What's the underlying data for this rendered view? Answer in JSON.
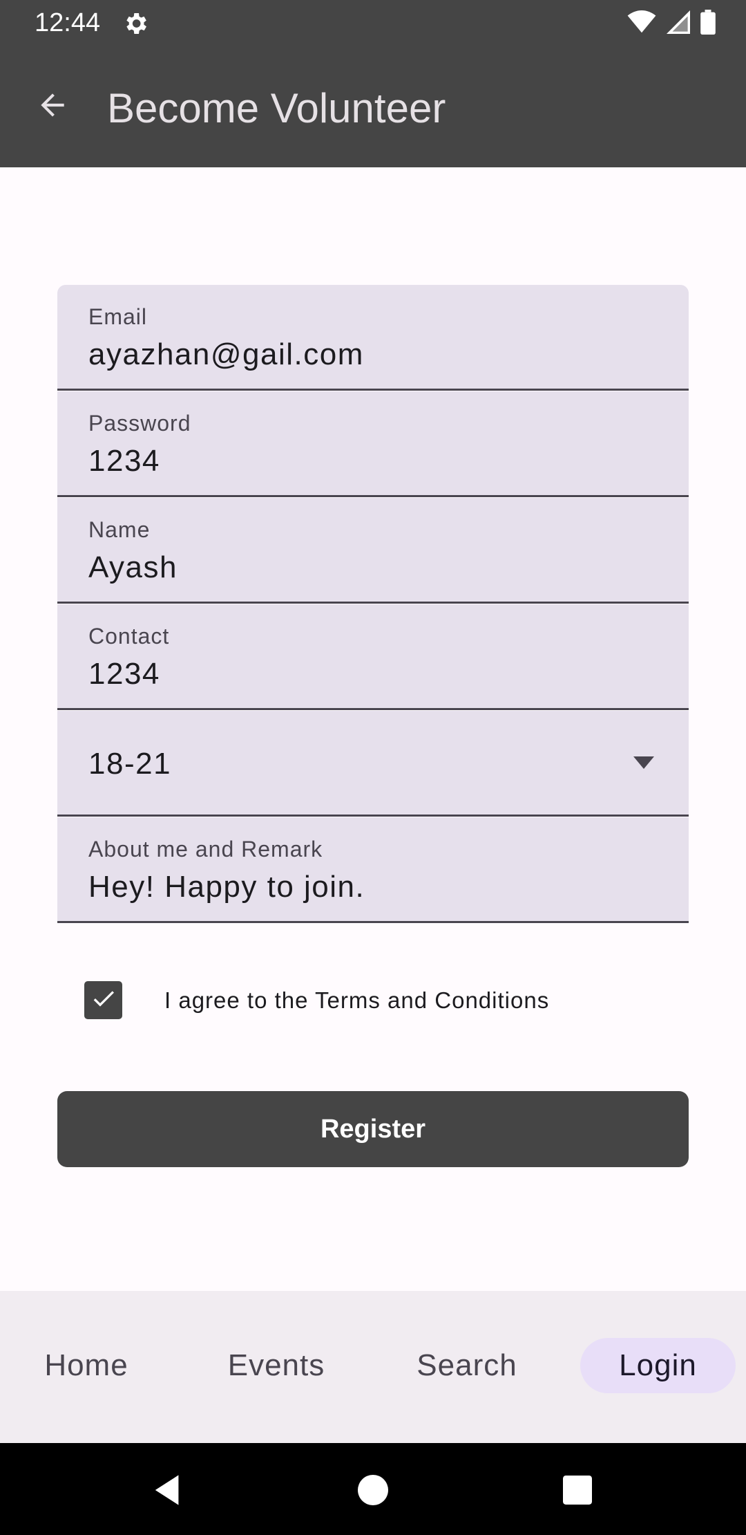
{
  "status_bar": {
    "time": "12:44",
    "icons": [
      "gear-icon",
      "wifi-icon",
      "signal-icon",
      "battery-icon"
    ]
  },
  "app_bar": {
    "title": "Become Volunteer",
    "back_icon": "arrow-back-icon"
  },
  "form": {
    "email": {
      "label": "Email",
      "value": "ayazhan@gail.com"
    },
    "password": {
      "label": "Password",
      "value": "1234"
    },
    "name": {
      "label": "Name",
      "value": "Ayash"
    },
    "contact": {
      "label": "Contact",
      "value": "1234"
    },
    "age_group": {
      "value": "18-21",
      "icon": "dropdown-arrow-icon"
    },
    "about": {
      "label": "About me and Remark",
      "value": "Hey! Happy to join."
    },
    "terms": {
      "label": "I agree to the Terms and Conditions",
      "checked": true
    },
    "register_label": "Register"
  },
  "bottom_nav": {
    "items": [
      {
        "label": "Home"
      },
      {
        "label": "Events"
      },
      {
        "label": "Search"
      },
      {
        "label": "Login",
        "active": true
      }
    ]
  },
  "system_nav": [
    "back-triangle-icon",
    "home-circle-icon",
    "recents-square-icon"
  ],
  "colors": {
    "app_bar": "#454545",
    "field_bg": "#E6E0EC",
    "accent_pill": "#E8DEF8",
    "nav_bg": "#F1ECF1"
  }
}
